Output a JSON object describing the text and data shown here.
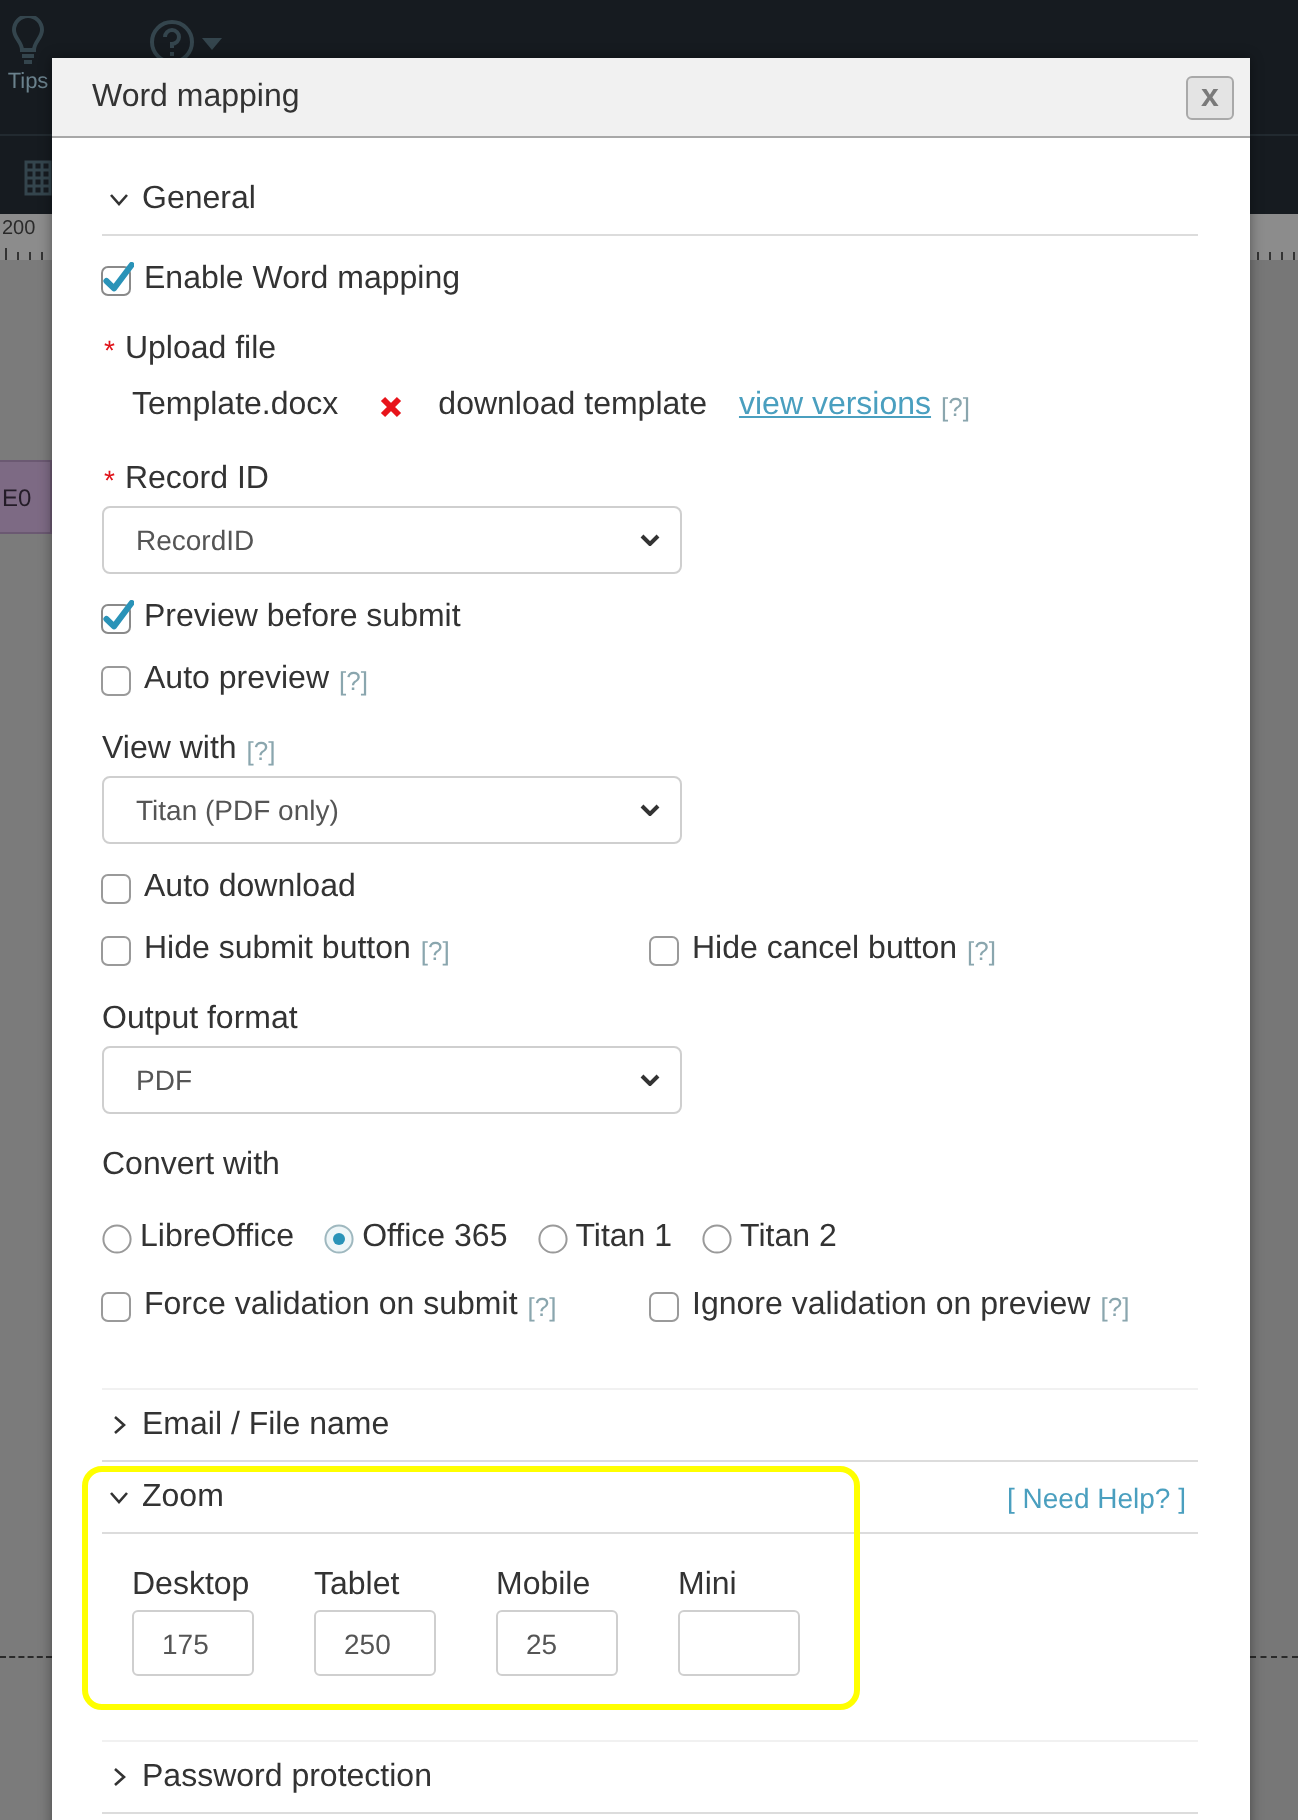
{
  "app_background": {
    "toolbar_label": "Tips",
    "ruler_label": "200",
    "block_label": "E0"
  },
  "dialog": {
    "title": "Word mapping",
    "close_label": "x",
    "sections": [
      {
        "title": "General",
        "expanded": true,
        "fields": [
          {
            "kind": "checks",
            "items": [
              {
                "label": "Enable Word mapping",
                "checked": true
              }
            ]
          },
          {
            "kind": "label",
            "text": "Upload file",
            "marker": "*"
          },
          {
            "kind": "file",
            "filename": "Template.docx",
            "action": "download template",
            "link": "view versions",
            "help": "[?]"
          },
          {
            "kind": "label",
            "text": "Record ID",
            "marker": "*"
          },
          {
            "kind": "select",
            "value": "RecordID"
          },
          {
            "kind": "checks",
            "items": [
              {
                "label": "Preview before submit",
                "checked": true
              }
            ]
          },
          {
            "kind": "checks",
            "items": [
              {
                "label": "Auto preview",
                "checked": false,
                "help": "[?]"
              }
            ]
          },
          {
            "kind": "label",
            "text": "View with",
            "help": "[?]"
          },
          {
            "kind": "select",
            "value": "Titan (PDF only)"
          },
          {
            "kind": "checks",
            "items": [
              {
                "label": "Auto download",
                "checked": false
              }
            ]
          },
          {
            "kind": "checks",
            "items": [
              {
                "label": "Hide submit button",
                "checked": false,
                "help": "[?]"
              },
              {
                "label": "Hide cancel button",
                "checked": false,
                "help": "[?]"
              }
            ]
          },
          {
            "kind": "label",
            "text": "Output format"
          },
          {
            "kind": "select",
            "value": "PDF"
          },
          {
            "kind": "label",
            "text": "Convert with"
          },
          {
            "kind": "radios",
            "options": [
              {
                "label": "LibreOffice",
                "selected": false
              },
              {
                "label": "Office 365",
                "selected": true
              },
              {
                "label": "Titan 1",
                "selected": false
              },
              {
                "label": "Titan 2",
                "selected": false
              }
            ]
          },
          {
            "kind": "checks",
            "items": [
              {
                "label": "Force validation on submit",
                "checked": false,
                "help": "[?]"
              },
              {
                "label": "Ignore validation on preview",
                "checked": false,
                "help": "[?]"
              }
            ]
          }
        ]
      },
      {
        "title": "Email / File name",
        "expanded": false
      },
      {
        "title": "Zoom",
        "expanded": true,
        "highlighted": true,
        "help_link": "[ Need Help? ]",
        "inputs": [
          {
            "label": "Desktop",
            "value": "175"
          },
          {
            "label": "Tablet",
            "value": "250"
          },
          {
            "label": "Mobile",
            "value": "25"
          },
          {
            "label": "Mini"
          }
        ]
      },
      {
        "title": "Password protection",
        "expanded": false
      }
    ]
  }
}
